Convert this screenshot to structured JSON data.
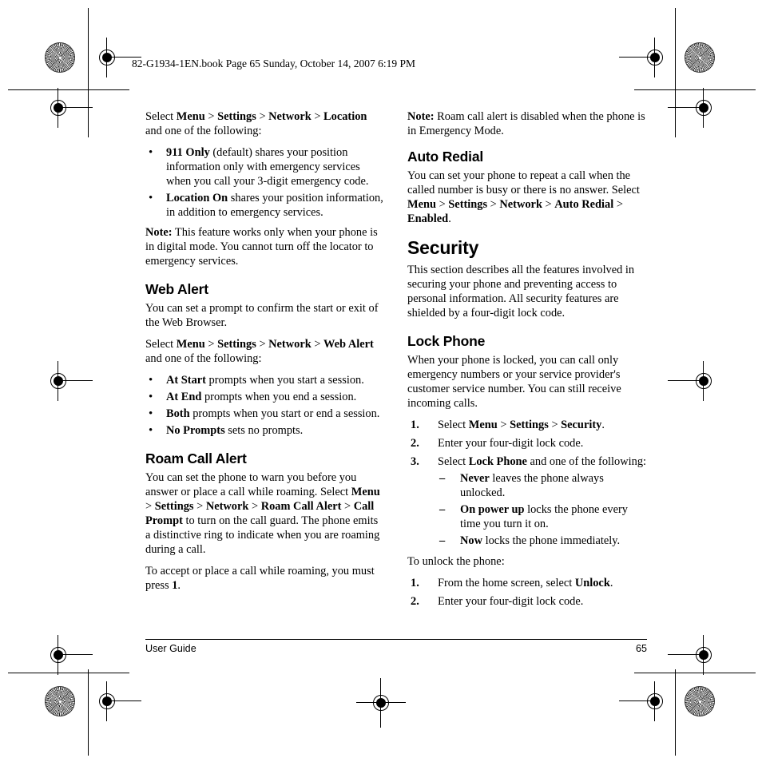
{
  "header": {
    "crop_header": "82-G1934-1EN.book  Page 65  Sunday, October 14, 2007  6:19 PM"
  },
  "footer": {
    "left": "User Guide",
    "page_number": "65"
  },
  "left_column": {
    "location_intro": "Select <b>Menu</b> > <b>Settings</b> > <b>Network</b> > <b>Location</b> and one of the following:",
    "location_bullets": [
      "<b>911 Only</b> (default) shares your position information only with emergency services when you call your 3-digit emergency code.",
      "<b>Location On</b> shares your position information, in addition to emergency services."
    ],
    "location_note": "<b>Note:</b> This feature works only when your phone is in digital mode. You cannot turn off the locator to emergency services.",
    "web_alert": {
      "heading": "Web Alert",
      "intro": "You can set a prompt to confirm the start or exit of the Web Browser.",
      "select_line": "Select <b>Menu</b> > <b>Settings</b> > <b>Network</b> > <b>Web Alert</b> and one of the following:",
      "bullets": [
        "<b>At Start</b> prompts when you start a session.",
        "<b>At End</b> prompts when you end a session.",
        "<b>Both</b> prompts when you start or end a session.",
        "<b>No Prompts</b> sets no prompts."
      ]
    },
    "roam_call_alert": {
      "heading": "Roam Call Alert",
      "body": "You can set the phone to warn you before you answer or place a call while roaming. Select <b>Menu</b> > <b>Settings</b> > <b>Network</b> > <b>Roam Call Alert</b> > <b>Call Prompt</b> to turn on the call guard. The phone emits a distinctive ring to indicate when you are roaming during a call.",
      "body2": "To accept or place a call while roaming, you must press <b>1</b>."
    }
  },
  "right_column": {
    "roam_note": "<b>Note:</b> Roam call alert is disabled when the phone is in Emergency Mode.",
    "auto_redial": {
      "heading": "Auto Redial",
      "body": "You can set your phone to repeat a call when the called number is busy or there is no answer. Select <b>Menu</b> > <b>Settings</b> > <b>Network</b> > <b>Auto Redial</b> > <b>Enabled</b>."
    },
    "security": {
      "heading": "Security",
      "body": "This section describes all the features involved in securing your phone and preventing access to personal information. All security features are shielded by a four-digit lock code."
    },
    "lock_phone": {
      "heading": "Lock Phone",
      "body": "When your phone is locked, you can call only emergency numbers or your service provider's customer service number. You can still receive incoming calls.",
      "step1": "Select <b>Menu</b> > <b>Settings</b> > <b>Security</b>.",
      "step2": "Enter your four-digit lock code.",
      "step3": "Select <b>Lock Phone</b> and one of the following:",
      "step3_options": [
        "<b>Never</b> leaves the phone always unlocked.",
        "<b>On power up</b> locks the phone every time you turn it on.",
        "<b>Now</b> locks the phone immediately."
      ],
      "unlock_intro": "To unlock the phone:",
      "unlock_step1": "From the home screen, select <b>Unlock</b>.",
      "unlock_step2": "Enter your four-digit lock code."
    }
  }
}
